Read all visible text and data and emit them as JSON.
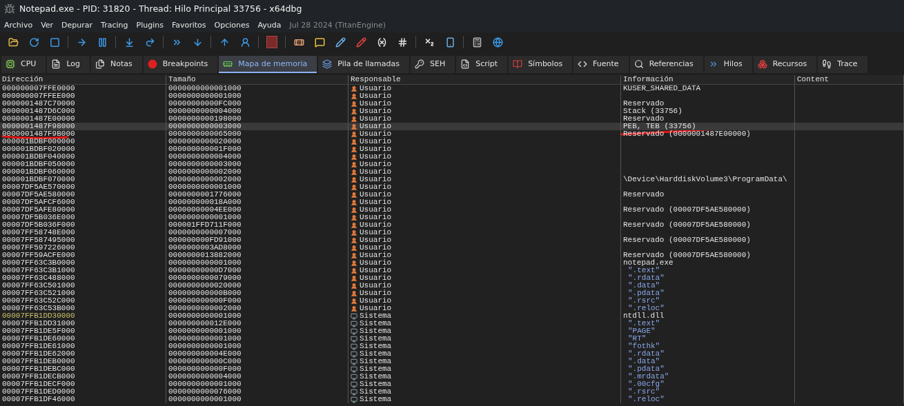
{
  "window": {
    "title": "Notepad.exe - PID: 31820 - Thread: Hilo Principal 33756 - x64dbg"
  },
  "menu": {
    "items": [
      {
        "label": "Archivo"
      },
      {
        "label": "Ver"
      },
      {
        "label": "Depurar"
      },
      {
        "label": "Tracing"
      },
      {
        "label": "Plugins"
      },
      {
        "label": "Favoritos"
      },
      {
        "label": "Opciones"
      },
      {
        "label": "Ayuda"
      }
    ],
    "build_note": "Jul 28 2024 (TitanEngine)"
  },
  "tabs": [
    {
      "label": "CPU",
      "selected": false
    },
    {
      "label": "Log",
      "selected": false
    },
    {
      "label": "Notas",
      "selected": false
    },
    {
      "label": "Breakpoints",
      "selected": false
    },
    {
      "label": "Mapa de memoria",
      "selected": true
    },
    {
      "label": "Pila de llamadas",
      "selected": false
    },
    {
      "label": "SEH",
      "selected": false
    },
    {
      "label": "Script",
      "selected": false
    },
    {
      "label": "Símbolos",
      "selected": false
    },
    {
      "label": "Fuente",
      "selected": false
    },
    {
      "label": "Referencias",
      "selected": false
    },
    {
      "label": "Hilos",
      "selected": false
    },
    {
      "label": "Recursos",
      "selected": false
    },
    {
      "label": "Trace",
      "selected": false
    }
  ],
  "table": {
    "columns": [
      "Dirección",
      "Tamaño",
      "Responsable",
      "Información",
      "Content"
    ],
    "rows": [
      {
        "address": "000000007FFE0000",
        "size": "0000000000001000",
        "owner": "Usuario",
        "system_owner": false,
        "info": "KUSER_SHARED_DATA",
        "section": false,
        "selected": false,
        "module_base": false
      },
      {
        "address": "000000007FFEE000",
        "size": "0000000000001000",
        "owner": "Usuario",
        "system_owner": false,
        "selected": false,
        "module_base": false
      },
      {
        "address": "0000001487C70000",
        "size": "00000000000FC000",
        "owner": "Usuario",
        "system_owner": false,
        "info": "Reservado",
        "section": false,
        "selected": false,
        "module_base": false
      },
      {
        "address": "0000001487D6C000",
        "size": "0000000000004000",
        "owner": "Usuario",
        "system_owner": false,
        "info": "Stack (33756)",
        "section": false,
        "selected": false,
        "module_base": false
      },
      {
        "address": "0000001487E00000",
        "size": "0000000000198000",
        "owner": "Usuario",
        "system_owner": false,
        "info": "Reservado",
        "section": false,
        "selected": false,
        "module_base": false
      },
      {
        "address": "0000001487F98000",
        "size": "0000000000003000",
        "owner": "Usuario",
        "system_owner": false,
        "info": "PEB, TEB (33756)",
        "section": false,
        "selected": true,
        "module_base": false
      },
      {
        "address": "0000001487F9B000",
        "size": "0000000000065000",
        "owner": "Usuario",
        "system_owner": false,
        "info": "Reservado (0000001487E00000)",
        "section": false,
        "selected": false,
        "module_base": false
      },
      {
        "address": "000001BDBF000000",
        "size": "0000000000020000",
        "owner": "Usuario",
        "system_owner": false,
        "selected": false,
        "module_base": false
      },
      {
        "address": "000001BDBF020000",
        "size": "000000000001F000",
        "owner": "Usuario",
        "system_owner": false,
        "selected": false,
        "module_base": false
      },
      {
        "address": "000001BDBF040000",
        "size": "0000000000004000",
        "owner": "Usuario",
        "system_owner": false,
        "selected": false,
        "module_base": false
      },
      {
        "address": "000001BDBF050000",
        "size": "0000000000003000",
        "owner": "Usuario",
        "system_owner": false,
        "selected": false,
        "module_base": false
      },
      {
        "address": "000001BDBF060000",
        "size": "0000000000002000",
        "owner": "Usuario",
        "system_owner": false,
        "selected": false,
        "module_base": false
      },
      {
        "address": "000001BDBF070000",
        "size": "0000000000002000",
        "owner": "Usuario",
        "system_owner": false,
        "info": "\\Device\\HarddiskVolume3\\ProgramData\\",
        "section": false,
        "selected": false,
        "module_base": false
      },
      {
        "address": "00007DF5AE570000",
        "size": "0000000000001000",
        "owner": "Usuario",
        "system_owner": false,
        "selected": false,
        "module_base": false
      },
      {
        "address": "00007DF5AE580000",
        "size": "0000000001776000",
        "owner": "Usuario",
        "system_owner": false,
        "info": "Reservado",
        "section": false,
        "selected": false,
        "module_base": false
      },
      {
        "address": "00007DF5AFCF6000",
        "size": "000000000018A000",
        "owner": "Usuario",
        "system_owner": false,
        "selected": false,
        "module_base": false
      },
      {
        "address": "00007DF5AFE80000",
        "size": "00000000004EE000",
        "owner": "Usuario",
        "system_owner": false,
        "info": "Reservado (00007DF5AE580000)",
        "section": false,
        "selected": false,
        "module_base": false
      },
      {
        "address": "00007DF5B036E000",
        "size": "0000000000001000",
        "owner": "Usuario",
        "system_owner": false,
        "selected": false,
        "module_base": false
      },
      {
        "address": "00007DF5B036F000",
        "size": "000001FFD711F000",
        "owner": "Usuario",
        "system_owner": false,
        "info": "Reservado (00007DF5AE580000)",
        "section": false,
        "selected": false,
        "module_base": false
      },
      {
        "address": "00007FF58748E000",
        "size": "0000000000007000",
        "owner": "Usuario",
        "system_owner": false,
        "selected": false,
        "module_base": false
      },
      {
        "address": "00007FF587495000",
        "size": "000000000FD91000",
        "owner": "Usuario",
        "system_owner": false,
        "info": "Reservado (00007DF5AE580000)",
        "section": false,
        "selected": false,
        "module_base": false
      },
      {
        "address": "00007FF597226000",
        "size": "0000000003AD8000",
        "owner": "Usuario",
        "system_owner": false,
        "selected": false,
        "module_base": false
      },
      {
        "address": "00007FF59ACFE000",
        "size": "0000000013882000",
        "owner": "Usuario",
        "system_owner": false,
        "info": "Reservado (00007DF5AE580000)",
        "section": false,
        "selected": false,
        "module_base": false
      },
      {
        "address": "00007FF63C3B0000",
        "size": "0000000000001000",
        "owner": "Usuario",
        "system_owner": false,
        "info": "notepad.exe",
        "section": false,
        "selected": false,
        "module_base": false
      },
      {
        "address": "00007FF63C3B1000",
        "size": "00000000000D7000",
        "owner": "Usuario",
        "system_owner": false,
        "info": "\".text\"",
        "section": true,
        "selected": false,
        "module_base": false
      },
      {
        "address": "00007FF63C488000",
        "size": "0000000000079000",
        "owner": "Usuario",
        "system_owner": false,
        "info": "\".rdata\"",
        "section": true,
        "selected": false,
        "module_base": false
      },
      {
        "address": "00007FF63C501000",
        "size": "0000000000020000",
        "owner": "Usuario",
        "system_owner": false,
        "info": "\".data\"",
        "section": true,
        "selected": false,
        "module_base": false
      },
      {
        "address": "00007FF63C521000",
        "size": "000000000000B000",
        "owner": "Usuario",
        "system_owner": false,
        "info": "\".pdata\"",
        "section": true,
        "selected": false,
        "module_base": false
      },
      {
        "address": "00007FF63C52C000",
        "size": "000000000000F000",
        "owner": "Usuario",
        "system_owner": false,
        "info": "\".rsrc\"",
        "section": true,
        "selected": false,
        "module_base": false
      },
      {
        "address": "00007FF63C53B000",
        "size": "0000000000002000",
        "owner": "Usuario",
        "system_owner": false,
        "info": "\".reloc\"",
        "section": true,
        "selected": false,
        "module_base": false
      },
      {
        "address": "00007FFB1DD30000",
        "size": "0000000000001000",
        "owner": "Sistema",
        "system_owner": true,
        "info": "ntdll.dll",
        "section": false,
        "selected": false,
        "module_base": true
      },
      {
        "address": "00007FFB1DD31000",
        "size": "000000000012E000",
        "owner": "Sistema",
        "system_owner": true,
        "info": "\".text\"",
        "section": true,
        "selected": false,
        "module_base": false
      },
      {
        "address": "00007FFB1DE5F000",
        "size": "0000000000001000",
        "owner": "Sistema",
        "system_owner": true,
        "info": "\"PAGE\"",
        "section": true,
        "selected": false,
        "module_base": false
      },
      {
        "address": "00007FFB1DE60000",
        "size": "0000000000001000",
        "owner": "Sistema",
        "system_owner": true,
        "info": "\"RT\"",
        "section": true,
        "selected": false,
        "module_base": false
      },
      {
        "address": "00007FFB1DE61000",
        "size": "0000000000001000",
        "owner": "Sistema",
        "system_owner": true,
        "info": "\"fothk\"",
        "section": true,
        "selected": false,
        "module_base": false
      },
      {
        "address": "00007FFB1DE62000",
        "size": "000000000004E000",
        "owner": "Sistema",
        "system_owner": true,
        "info": "\".rdata\"",
        "section": true,
        "selected": false,
        "module_base": false
      },
      {
        "address": "00007FFB1DEB0000",
        "size": "000000000000C000",
        "owner": "Sistema",
        "system_owner": true,
        "info": "\".data\"",
        "section": true,
        "selected": false,
        "module_base": false
      },
      {
        "address": "00007FFB1DEBC000",
        "size": "000000000000F000",
        "owner": "Sistema",
        "system_owner": true,
        "info": "\".pdata\"",
        "section": true,
        "selected": false,
        "module_base": false
      },
      {
        "address": "00007FFB1DECB000",
        "size": "0000000000004000",
        "owner": "Sistema",
        "system_owner": true,
        "info": "\".mrdata\"",
        "section": true,
        "selected": false,
        "module_base": false
      },
      {
        "address": "00007FFB1DECF000",
        "size": "0000000000001000",
        "owner": "Sistema",
        "system_owner": true,
        "info": "\".00cfg\"",
        "section": true,
        "selected": false,
        "module_base": false
      },
      {
        "address": "00007FFB1DED0000",
        "size": "0000000000076000",
        "owner": "Sistema",
        "system_owner": true,
        "info": "\".rsrc\"",
        "section": true,
        "selected": false,
        "module_base": false
      },
      {
        "address": "00007FFB1DF46000",
        "size": "0000000000001000",
        "owner": "Sistema",
        "system_owner": true,
        "info": "\".reloc\"",
        "section": true,
        "selected": false,
        "module_base": false
      }
    ]
  }
}
